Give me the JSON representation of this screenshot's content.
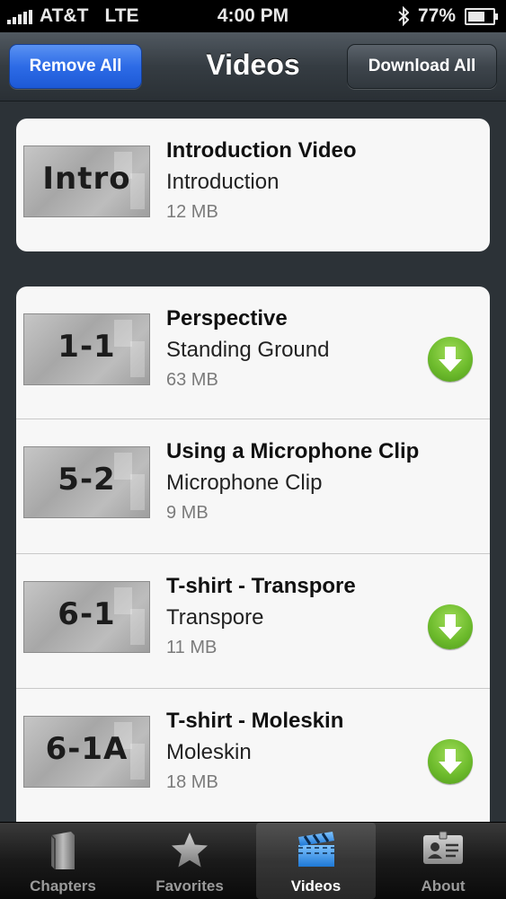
{
  "status_bar": {
    "carrier": "AT&T",
    "network": "LTE",
    "time": "4:00 PM",
    "battery": "77%",
    "battery_level": 0.77
  },
  "navbar": {
    "left_button": "Remove All",
    "title": "Videos",
    "right_button": "Download All"
  },
  "groups": [
    {
      "rows": [
        {
          "thumb": "Intro",
          "title": "Introduction Video",
          "subtitle": "Introduction",
          "size": "12 MB",
          "downloadable": false
        }
      ]
    },
    {
      "rows": [
        {
          "thumb": "1-1",
          "title": "Perspective",
          "subtitle": "Standing Ground",
          "size": "63 MB",
          "downloadable": true
        },
        {
          "thumb": "5-2",
          "title": "Using a Microphone Clip",
          "subtitle": "Microphone Clip",
          "size": "9 MB",
          "downloadable": false
        },
        {
          "thumb": "6-1",
          "title": "T-shirt - Transpore",
          "subtitle": "Transpore",
          "size": "11 MB",
          "downloadable": true
        },
        {
          "thumb": "6-1A",
          "title": "T-shirt - Moleskin",
          "subtitle": "Moleskin",
          "size": "18 MB",
          "downloadable": true
        }
      ]
    }
  ],
  "tab_bar": {
    "tabs": [
      {
        "label": "Chapters",
        "icon": "book-icon",
        "active": false
      },
      {
        "label": "Favorites",
        "icon": "star-icon",
        "active": false
      },
      {
        "label": "Videos",
        "icon": "clapperboard-icon",
        "active": true
      },
      {
        "label": "About",
        "icon": "id-card-icon",
        "active": false
      }
    ]
  },
  "colors": {
    "accent_blue": "#2d6be6",
    "download_green": "#6ebc2d",
    "active_tab_icon": "#3a9ff0"
  }
}
